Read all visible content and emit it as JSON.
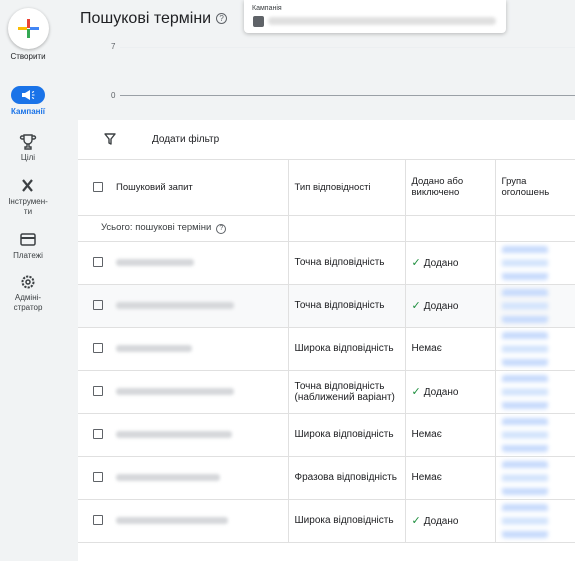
{
  "sidebar": {
    "create_label": "Створити",
    "items": [
      {
        "label": "Кампанії",
        "icon": "megaphone-icon",
        "active": true
      },
      {
        "label": "Цілі",
        "icon": "trophy-icon"
      },
      {
        "label": "Інструмен-\nти",
        "icon": "tools-icon"
      },
      {
        "label": "Платежі",
        "icon": "credit-card-icon"
      },
      {
        "label": "Адміні-\nстратор",
        "icon": "gear-icon"
      }
    ]
  },
  "header": {
    "title": "Пошукові терміни",
    "campaign_label": "Кампанія"
  },
  "chart": {
    "y_ticks": [
      "7",
      "0"
    ]
  },
  "filter_bar": {
    "add_filter": "Додати фільтр"
  },
  "table": {
    "headers": [
      "Пошуковий запит",
      "Тип відповідності",
      "Додано або виключено",
      "Група оголошень"
    ],
    "total_label": "Усього: пошукові терміни",
    "rows": [
      {
        "match_type": "Точна відповідність",
        "status": "Додано",
        "added": true
      },
      {
        "match_type": "Точна відповідність",
        "status": "Додано",
        "added": true
      },
      {
        "match_type": "Широка відповідність",
        "status": "Немає",
        "added": false
      },
      {
        "match_type": "Точна відповідність (наближений варіант)",
        "status": "Додано",
        "added": true
      },
      {
        "match_type": "Широка відповідність",
        "status": "Немає",
        "added": false
      },
      {
        "match_type": "Фразова відповідність",
        "status": "Немає",
        "added": false
      },
      {
        "match_type": "Широка відповідність",
        "status": "Додано",
        "added": true
      }
    ]
  },
  "colors": {
    "accent": "#1a73e8",
    "added_check": "#1e8e3e"
  }
}
